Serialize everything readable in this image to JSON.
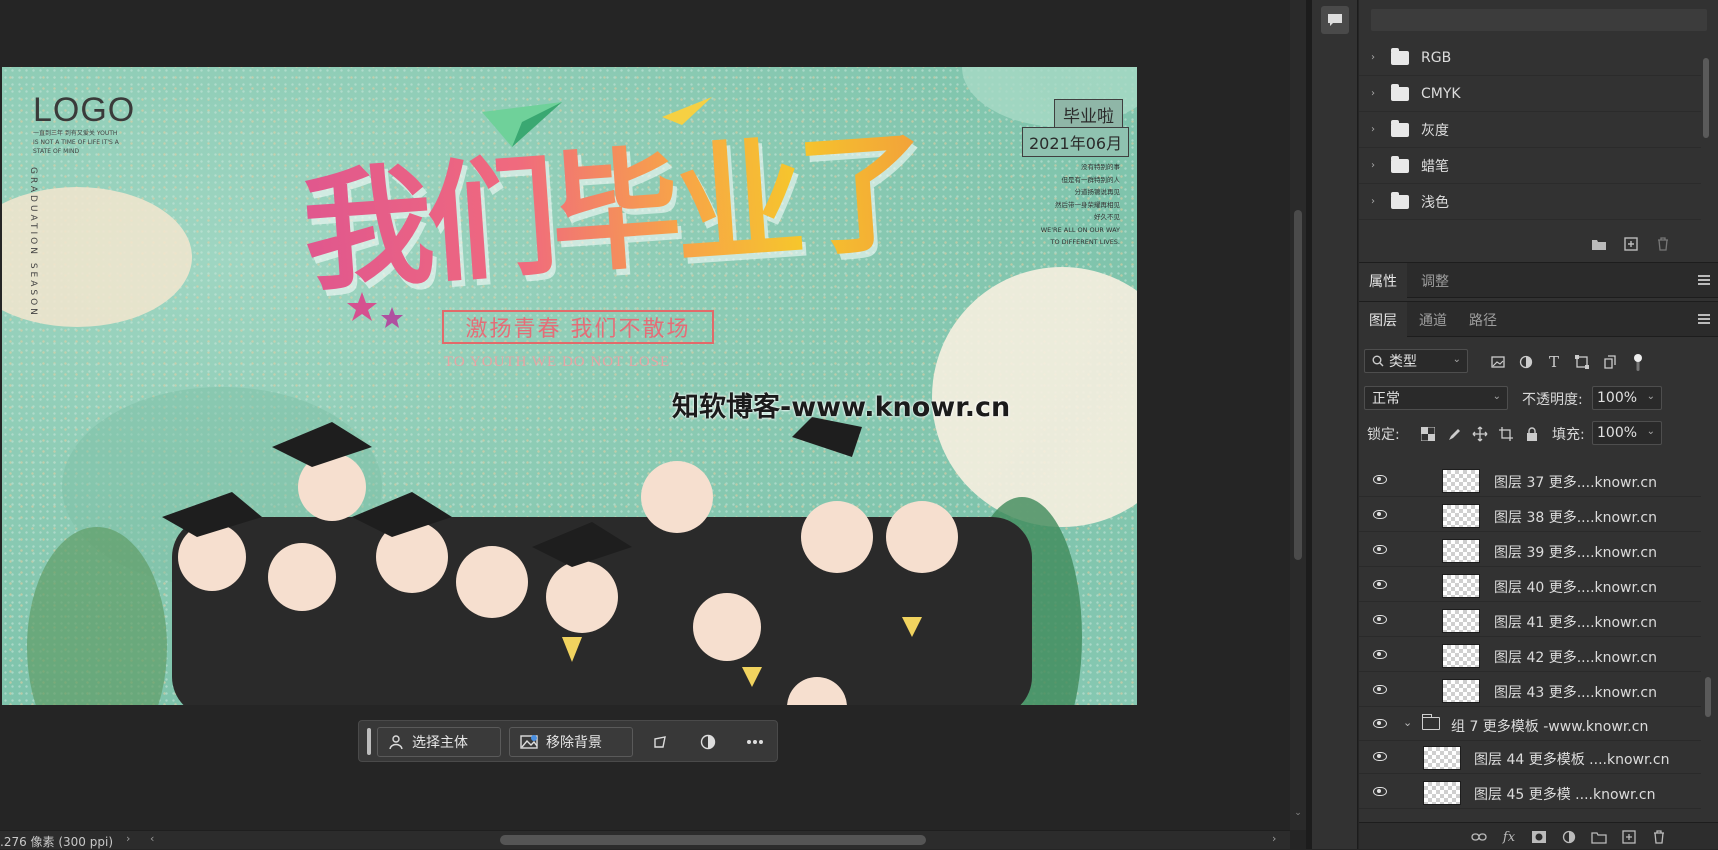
{
  "canvas": {
    "logo": "LOGO",
    "logo_sub": "一直到三年 到有又爱关 YOUTH IS NOT A TIME OF LIFE IT'S A STATE OF MIND",
    "vertical_text": "GRADUATION SEASON",
    "title": "我们毕业了",
    "subtitle": "激扬青春 我们不散场",
    "subtitle_en": "TO YOUTH WE DO NOT LOSE",
    "tag_graduate": "毕业啦",
    "tag_date": "2021年06月",
    "right_lines": [
      "没有特别的事",
      "但是有一群特别的人",
      "分道扬镳说再见",
      "然后带一身荣耀再相见",
      "好久不见",
      "WE'RE ALL ON OUR WAY",
      "TO DIFFERENT LIVES."
    ],
    "watermark": "知软博客-www.knowr.cn"
  },
  "context_bar": {
    "select_subject": "选择主体",
    "remove_background": "移除背景"
  },
  "status_bar": {
    "info": ".276 像素 (300 ppi)"
  },
  "swatches": {
    "groups": [
      "RGB",
      "CMYK",
      "灰度",
      "蜡笔",
      "浅色"
    ]
  },
  "properties_tabs": [
    "属性",
    "调整"
  ],
  "layers_tabs": [
    "图层",
    "通道",
    "路径"
  ],
  "layers_panel": {
    "filter_kind": "类型",
    "blend_mode": "正常",
    "opacity_label": "不透明度:",
    "opacity_value": "100%",
    "lock_label": "锁定:",
    "fill_label": "填充:",
    "fill_value": "100%",
    "layers": [
      {
        "name": "图层 37  更多....knowr.cn",
        "indent": 2
      },
      {
        "name": "图层 38  更多....knowr.cn",
        "indent": 2
      },
      {
        "name": "图层 39  更多....knowr.cn",
        "indent": 2
      },
      {
        "name": "图层 40  更多....knowr.cn",
        "indent": 2
      },
      {
        "name": "图层 41  更多....knowr.cn",
        "indent": 2
      },
      {
        "name": "图层 42  更多....knowr.cn",
        "indent": 2
      },
      {
        "name": "图层 43  更多....knowr.cn",
        "indent": 2
      },
      {
        "name": "组 7  更多模板 -www.knowr.cn",
        "group": true
      },
      {
        "name": "图层 44 更多模板 ....knowr.cn",
        "indent": 1
      },
      {
        "name": "图层 45  更多模 ....knowr.cn",
        "indent": 1
      }
    ]
  },
  "colors": {
    "canvas_bg": "#8ccbb4",
    "workspace": "#252525",
    "panel": "#323232",
    "title_pink": "#e0578e",
    "title_yellow": "#f6c62c"
  }
}
